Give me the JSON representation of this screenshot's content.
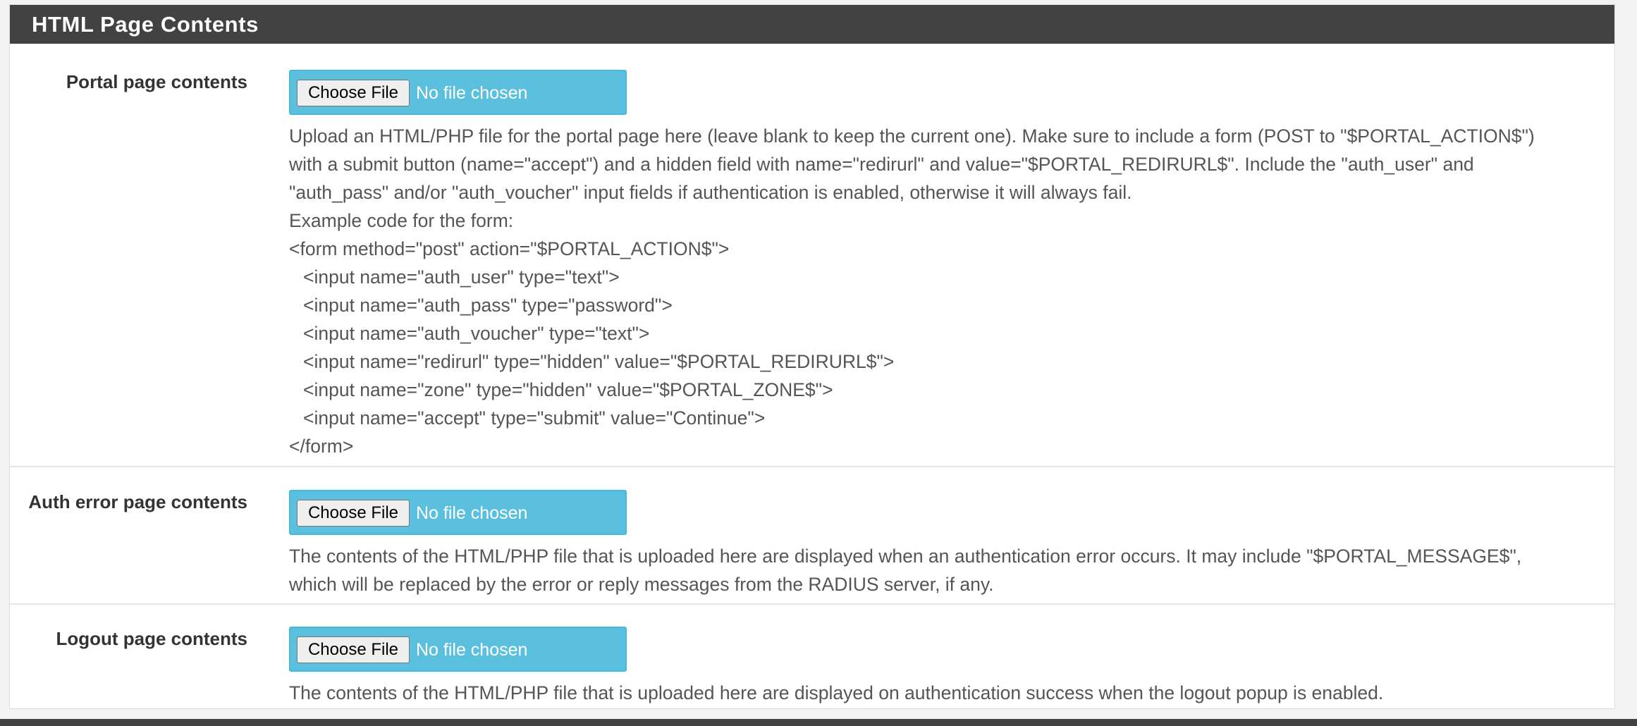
{
  "panel": {
    "title": "HTML Page Contents"
  },
  "rows": {
    "portal": {
      "label": "Portal page contents",
      "choose_label": "Choose File",
      "file_status": "No file chosen",
      "help_lines": [
        "Upload an HTML/PHP file for the portal page here (leave blank to keep the current one). Make sure to include a form (POST to \"$PORTAL_ACTION$\")",
        "with a submit button (name=\"accept\") and a hidden field with name=\"redirurl\" and value=\"$PORTAL_REDIRURL$\". Include the \"auth_user\" and",
        "\"auth_pass\" and/or \"auth_voucher\" input fields if authentication is enabled, otherwise it will always fail.",
        "Example code for the form:",
        "<form method=\"post\" action=\"$PORTAL_ACTION$\">"
      ],
      "code_lines": [
        "<input name=\"auth_user\" type=\"text\">",
        "<input name=\"auth_pass\" type=\"password\">",
        "<input name=\"auth_voucher\" type=\"text\">",
        "<input name=\"redirurl\" type=\"hidden\" value=\"$PORTAL_REDIRURL$\">",
        "<input name=\"zone\" type=\"hidden\" value=\"$PORTAL_ZONE$\">",
        "<input name=\"accept\" type=\"submit\" value=\"Continue\">"
      ],
      "closing_line": "</form>"
    },
    "auth_error": {
      "label": "Auth error page contents",
      "choose_label": "Choose File",
      "file_status": "No file chosen",
      "help_lines": [
        "The contents of the HTML/PHP file that is uploaded here are displayed when an authentication error occurs. It may include \"$PORTAL_MESSAGE$\",",
        "which will be replaced by the error or reply messages from the RADIUS server, if any."
      ]
    },
    "logout": {
      "label": "Logout page contents",
      "choose_label": "Choose File",
      "file_status": "No file chosen",
      "help_lines": [
        "The contents of the HTML/PHP file that is uploaded here are displayed on authentication success when the logout popup is enabled."
      ]
    }
  },
  "colors": {
    "heading_bg": "#424242",
    "file_box_bg": "#5bc0de",
    "help_text": "#555555"
  }
}
